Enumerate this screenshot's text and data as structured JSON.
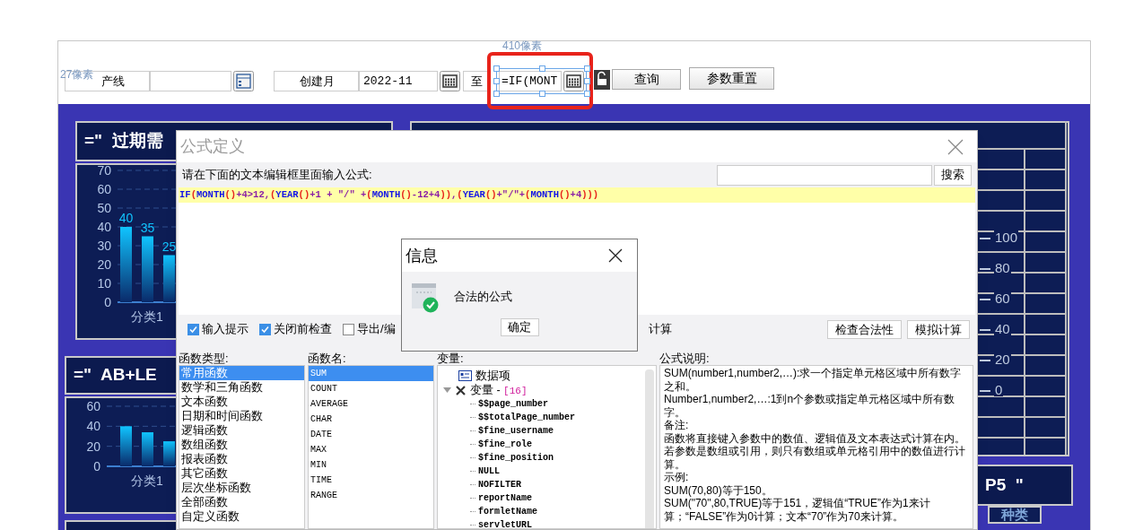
{
  "toolbar": {
    "width_note": "410像素",
    "height_note": "27像素",
    "line_label": "产线",
    "month_label": "创建月",
    "month_from": "2022-11",
    "to_label": "至",
    "month_to": "=IF(MONT",
    "month_to_selected": true,
    "query_button": "查询",
    "reset_button": "参数重置"
  },
  "panels": [
    {
      "title": "=\"  过期需",
      "chart_data": {
        "type": "bar",
        "categories": [
          "分类1"
        ],
        "yticks": [
          0,
          10,
          20,
          30,
          40,
          50,
          60,
          70
        ],
        "ylim": [
          0,
          70
        ],
        "grid": true,
        "data_labels": true,
        "series": [
          {
            "values": [
              40
            ]
          },
          {
            "values": [
              35
            ]
          },
          {
            "values": [
              25
            ]
          }
        ]
      }
    },
    {
      "title": "=\"  AB+LE",
      "chart_data": {
        "type": "bar",
        "categories": [
          "分类1"
        ],
        "yticks": [
          0,
          20,
          40,
          60
        ],
        "ylim": [
          0,
          60
        ],
        "grid": true,
        "series": [
          {
            "values": [
              40
            ]
          },
          {
            "values": [
              34
            ]
          },
          {
            "values": [
              25
            ]
          }
        ]
      }
    }
  ],
  "right_panel": {
    "axis_labels": [
      "100",
      "80",
      "60",
      "40",
      "20",
      "0"
    ]
  },
  "bottom_right_panel": {
    "title": "P5  \"",
    "column_header": "种类"
  },
  "formula_dialog": {
    "title": "公式定义",
    "prompt": "请在下面的文本编辑框里面输入公式:",
    "search_button": "搜索",
    "formula": "IF(MONTH()+4>12,(YEAR()+1 + \"/\" +(MONTH()-12+4)),(YEAR()+\"/\"+(MONTH()+4)))",
    "options": [
      {
        "label": "输入提示",
        "checked": true
      },
      {
        "label": "关闭前检查",
        "checked": true
      },
      {
        "label": "导出/编",
        "checked": false
      }
    ],
    "option_tail": "计算",
    "buttons": [
      "检查合法性",
      "模拟计算"
    ],
    "function_types": {
      "heading": "函数类型:",
      "items": [
        {
          "label": "常用函数",
          "selected": true
        },
        {
          "label": "数学和三角函数",
          "selected": false
        },
        {
          "label": "文本函数",
          "selected": false
        },
        {
          "label": "日期和时间函数",
          "selected": false
        },
        {
          "label": "逻辑函数",
          "selected": false
        },
        {
          "label": "数组函数",
          "selected": false
        },
        {
          "label": "报表函数",
          "selected": false
        },
        {
          "label": "其它函数",
          "selected": false
        },
        {
          "label": "层次坐标函数",
          "selected": false
        },
        {
          "label": "全部函数",
          "selected": false
        },
        {
          "label": "自定义函数",
          "selected": false
        }
      ]
    },
    "function_names": {
      "heading": "函数名:",
      "items": [
        {
          "label": "SUM",
          "selected": true
        },
        {
          "label": "COUNT",
          "selected": false
        },
        {
          "label": "AVERAGE",
          "selected": false
        },
        {
          "label": "CHAR",
          "selected": false
        },
        {
          "label": "DATE",
          "selected": false
        },
        {
          "label": "MAX",
          "selected": false
        },
        {
          "label": "MIN",
          "selected": false
        },
        {
          "label": "TIME",
          "selected": false
        },
        {
          "label": "RANGE",
          "selected": false
        }
      ]
    },
    "variables": {
      "heading": "变量:",
      "tree": [
        {
          "kind": "data",
          "label": "数据项"
        },
        {
          "kind": "group",
          "label": "变量 - ",
          "count": "[16]",
          "expanded": true,
          "children": [
            {
              "label": "$$page_number"
            },
            {
              "label": "$$totalPage_number"
            },
            {
              "label": "$fine_username"
            },
            {
              "label": "$fine_role"
            },
            {
              "label": "$fine_position"
            },
            {
              "label": "NULL"
            },
            {
              "label": "NOFILTER"
            },
            {
              "label": "reportName"
            },
            {
              "label": "formletName"
            },
            {
              "label": "servletURL"
            }
          ]
        }
      ]
    },
    "description": {
      "heading": "公式说明:",
      "paragraphs": [
        "SUM(number1,number2,…):求一个指定单元格区域中所有数字之和。",
        "Number1,number2,…:1到n个参数或指定单元格区域中所有数字。",
        "备注:",
        "函数将直接键入参数中的数值、逻辑值及文本表达式计算在内。若参数是数组或引用，则只有数组或单元格引用中的数值进行计算。",
        "示例:",
        "SUM(70,80)等于150。",
        "SUM(\"70\",80,TRUE)等于151，逻辑值“TRUE”作为1来计算；“FALSE”作为0计算；文本“70”作为70来计算。"
      ]
    }
  },
  "info_dialog": {
    "title": "信息",
    "message": "合法的公式",
    "ok_button": "确定"
  }
}
